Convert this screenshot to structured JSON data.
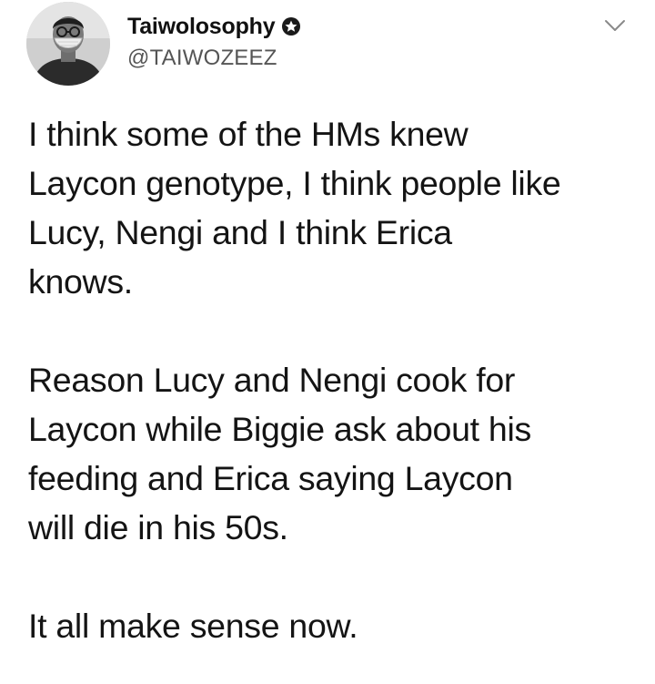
{
  "author": {
    "display_name": "Taiwolosophy",
    "handle": "@TAIWOZEEZ",
    "badge_icon": "verified-icon",
    "avatar_icon": "avatar-photo"
  },
  "menu": {
    "icon": "chevron-down-icon"
  },
  "tweet": {
    "paragraphs": [
      {
        "lines": [
          "I think some of the HMs knew",
          "Laycon genotype, I think people like",
          "Lucy, Nengi and I think Erica",
          "knows."
        ]
      },
      {
        "lines": [
          "Reason Lucy and Nengi cook for",
          "Laycon while Biggie ask about his",
          "feeding and Erica saying Laycon",
          "will die in his 50s."
        ]
      },
      {
        "lines": [
          "It all make sense now."
        ]
      }
    ]
  },
  "colors": {
    "text": "#141414",
    "handle": "#555555",
    "chevron": "#8a8a8a"
  }
}
